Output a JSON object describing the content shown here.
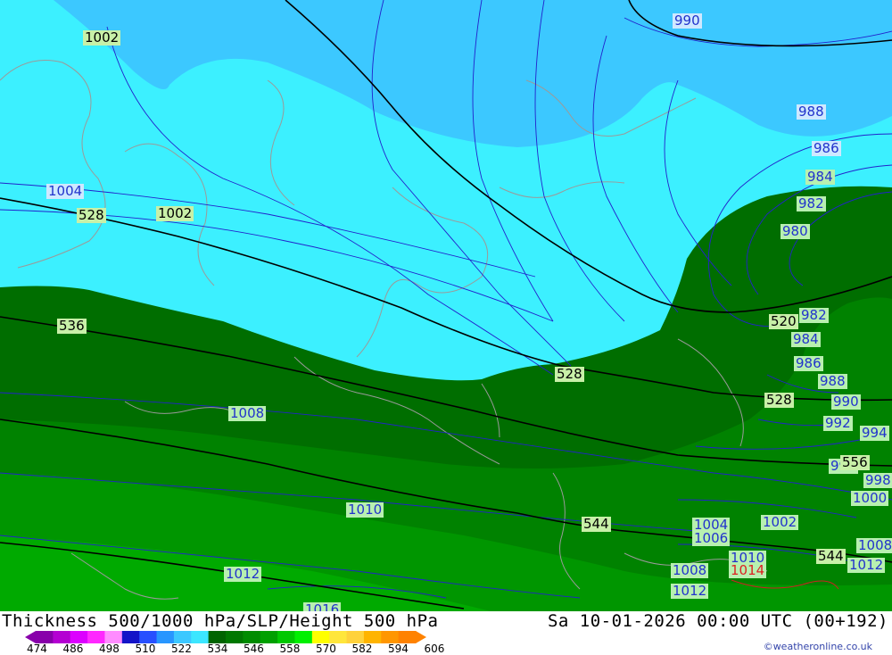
{
  "footer": {
    "title": "Thickness 500/1000 hPa/SLP/Height 500 hPa",
    "datetime": "Sa 10-01-2026 00:00 UTC (00+192)",
    "credit": "©weatheronline.co.uk"
  },
  "legend": {
    "ticks": [
      "474",
      "486",
      "498",
      "510",
      "522",
      "534",
      "546",
      "558",
      "570",
      "582",
      "594",
      "606"
    ],
    "colors": [
      "#8800aa",
      "#b400d2",
      "#dc00ff",
      "#ff28ff",
      "#ff8cff",
      "#1414c8",
      "#2850ff",
      "#2896ff",
      "#3cc8ff",
      "#3ce6ff",
      "#006400",
      "#007800",
      "#008c00",
      "#00a000",
      "#00c800",
      "#00f000",
      "#ffff00",
      "#ffe63c",
      "#ffd23c",
      "#ffb400",
      "#ff9600",
      "#ff8200"
    ]
  },
  "map_colors": {
    "band_522": "#3cc8ff",
    "band_528": "#3cf0ff",
    "band_534": "#006e00",
    "band_540": "#008200",
    "band_546": "#009600",
    "band_552": "#00aa00"
  },
  "map_labels": {
    "slp_990": "990",
    "slp_988a": "988",
    "slp_986a": "986",
    "slp_984a": "984",
    "slp_982a": "982",
    "slp_980": "980",
    "slp_1002a": "1002",
    "slp_1004a": "1004",
    "slp_1002b": "1002",
    "thk_528a": "528",
    "thk_536": "536",
    "thk_520": "520",
    "slp_982b": "982",
    "slp_984b": "984",
    "slp_986b": "986",
    "slp_988b": "988",
    "slp_990b": "990",
    "thk_528b": "528",
    "thk_528c": "528",
    "slp_992": "992",
    "slp_994": "994",
    "slp_996": "996",
    "thk_556": "556",
    "slp_998": "998",
    "slp_1000": "1000",
    "slp_1008a": "1008",
    "slp_1010a": "1010",
    "thk_544a": "544",
    "slp_1004b": "1004",
    "slp_1006": "1006",
    "slp_1002c": "1002",
    "thk_544b": "544",
    "slp_1008b": "1008",
    "slp_1012a": "1012",
    "slp_1010b": "1010",
    "slp_1014": "1014",
    "slp_1008c": "1008",
    "slp_1012b": "1012",
    "slp_1012c": "1012",
    "slp_1016": "1016"
  }
}
